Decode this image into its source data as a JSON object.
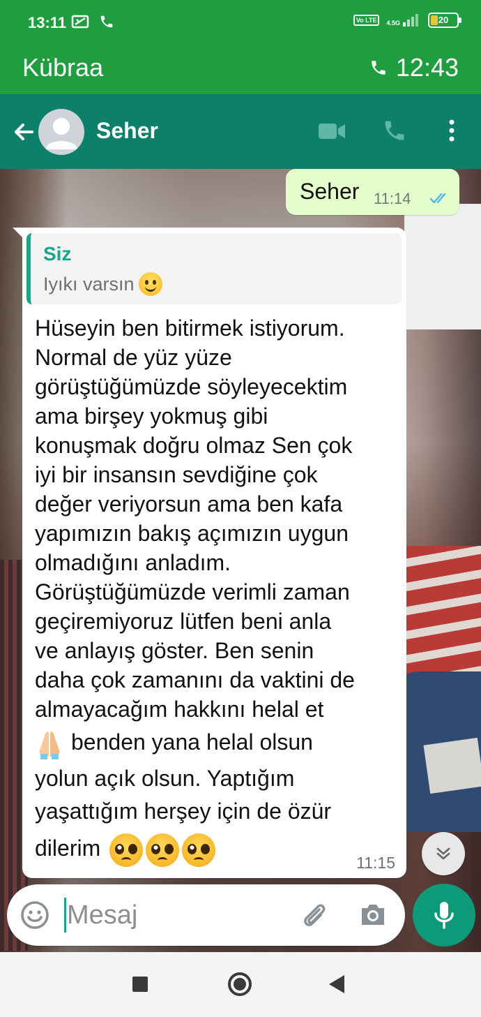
{
  "status_bar": {
    "time": "13:11",
    "network_label": "4.5G",
    "volte_label": "Vo LTE",
    "battery_level": "20"
  },
  "call_banner": {
    "caller_name": "Kübraa",
    "call_duration": "12:43"
  },
  "app_bar": {
    "contact_name": "Seher",
    "icons": [
      "back-arrow-icon",
      "avatar",
      "video-call-icon",
      "voice-call-icon",
      "more-vert-icon"
    ]
  },
  "messages": {
    "outgoing": {
      "text": "Seher",
      "time": "11:14",
      "status": "read"
    },
    "incoming": {
      "quote_author": "Siz",
      "quote_text": "Iyıkı varsın",
      "lines": [
        "Hüseyin ben bitirmek istiyorum.",
        "Normal de yüz yüze",
        "görüştüğümüzde söyleyecektim",
        "ama birşey yokmuş gibi",
        "konuşmak doğru olmaz Sen çok",
        "iyi bir insansın sevdiğine çok",
        "değer veriyorsun ama ben kafa",
        "yapımızın bakış açımızın uygun",
        "olmadığını anladım.",
        "Görüştüğümüzde verimli zaman",
        "geçiremiyoruz lütfen beni anla",
        "ve anlayış göster. Ben senin",
        "daha çok zamanını da vaktini de",
        "almayacağım hakkını helal et",
        "benden yana helal olsun",
        "yolun açık olsun. Yaptığım",
        "yaşattığım herşey için de özür",
        "dilerim"
      ],
      "time": "11:15"
    }
  },
  "composer": {
    "placeholder": "Mesaj"
  },
  "colors": {
    "status_green": "#1f9d3f",
    "header_teal": "#0c806b",
    "accent": "#17a689",
    "outgoing_bubble": "#e3fdcd"
  }
}
